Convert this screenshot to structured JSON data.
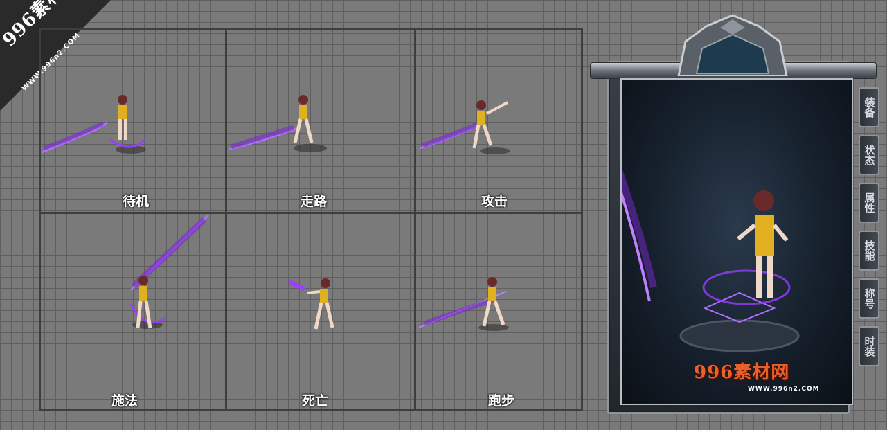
{
  "watermark": {
    "site": "996素材网",
    "url": "WWW.996n2.COM"
  },
  "animations": [
    {
      "label": "待机"
    },
    {
      "label": "走路"
    },
    {
      "label": "攻击"
    },
    {
      "label": "施法"
    },
    {
      "label": "死亡"
    },
    {
      "label": "跑步"
    }
  ],
  "panel": {
    "tabs": [
      {
        "label": "装备"
      },
      {
        "label": "状态"
      },
      {
        "label": "属性"
      },
      {
        "label": "技能"
      },
      {
        "label": "称号"
      },
      {
        "label": "时装"
      }
    ],
    "logo_text": "996素材网",
    "logo_url": "WWW.996n2.COM"
  },
  "colors": {
    "weapon_glow": "#9b3cff",
    "skin": "#f0d8c8",
    "outfit": "#e0b020",
    "hair": "#6a2a2a"
  }
}
